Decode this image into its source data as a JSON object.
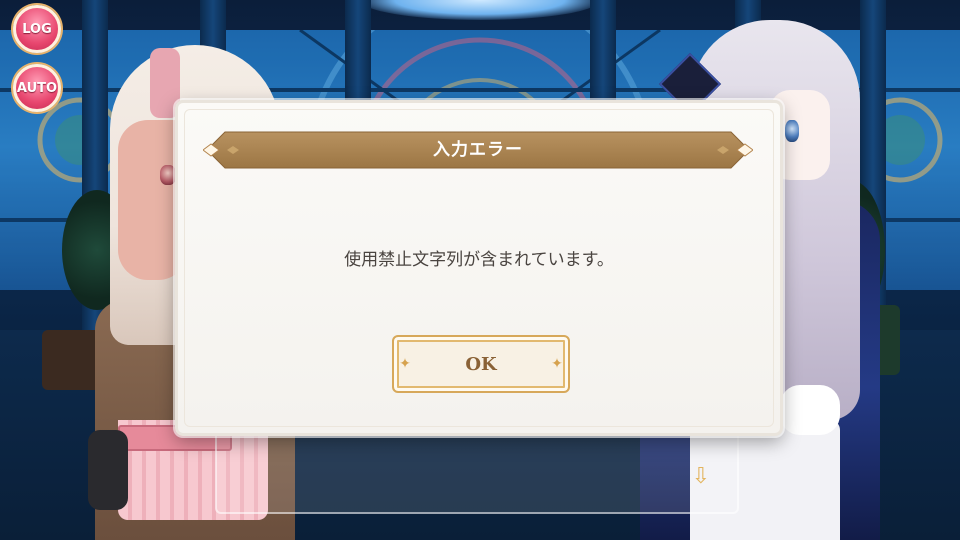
{
  "side_buttons": {
    "log_label": "LOG",
    "auto_label": "AUTO"
  },
  "dialog": {
    "title": "入力エラー",
    "message": "使用禁止文字列が含まれています。",
    "ok_label": "OK"
  },
  "colors": {
    "banner": "#a8824e",
    "button_border": "#d7a85a",
    "side_button": "#e8476f",
    "text": "#4a4440"
  },
  "icons": {
    "next_arrow": "chevron-down-icon",
    "banner_ornament": "diamond-ornament-icon"
  }
}
